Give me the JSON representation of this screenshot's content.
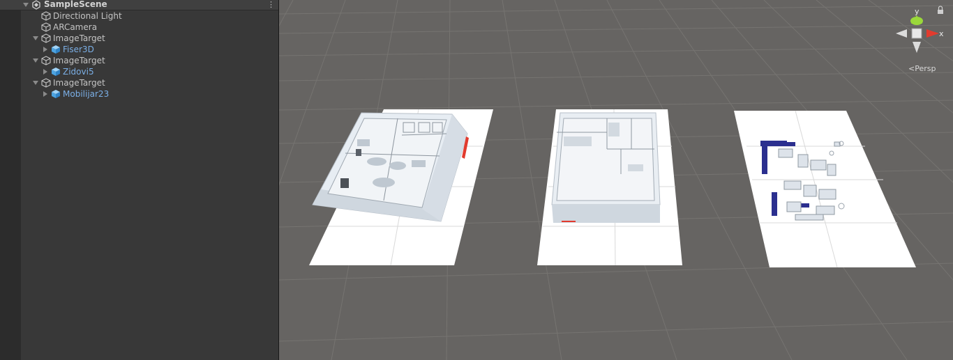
{
  "hierarchy": {
    "scene": {
      "name": "SampleScene",
      "menu_icon": "kebab-menu-icon"
    },
    "items": [
      {
        "label": "Directional Light",
        "type": "gameobject",
        "icon": "cube-outline-icon"
      },
      {
        "label": "ARCamera",
        "type": "gameobject",
        "icon": "cube-outline-icon"
      },
      {
        "label": "ImageTarget",
        "type": "gameobject",
        "icon": "cube-outline-icon",
        "expanded": true
      },
      {
        "label": "Fiser3D",
        "type": "prefab",
        "icon": "prefab-cube-icon"
      },
      {
        "label": "ImageTarget",
        "type": "gameobject",
        "icon": "cube-outline-icon",
        "expanded": true
      },
      {
        "label": "Zidovi5",
        "type": "prefab",
        "icon": "prefab-cube-icon"
      },
      {
        "label": "ImageTarget",
        "type": "gameobject",
        "icon": "cube-outline-icon",
        "expanded": true
      },
      {
        "label": "Mobilijar23",
        "type": "prefab",
        "icon": "prefab-cube-icon"
      }
    ]
  },
  "scene_view": {
    "gizmo": {
      "y_label": "y",
      "x_label": "x",
      "projection_label": "Persp",
      "lock_icon": "lock-icon"
    },
    "colors": {
      "background": "#666462",
      "grid": "#7a7875",
      "target": "#ffffff",
      "x_axis": "#e23b2e",
      "y_axis": "#9ad83a"
    }
  }
}
